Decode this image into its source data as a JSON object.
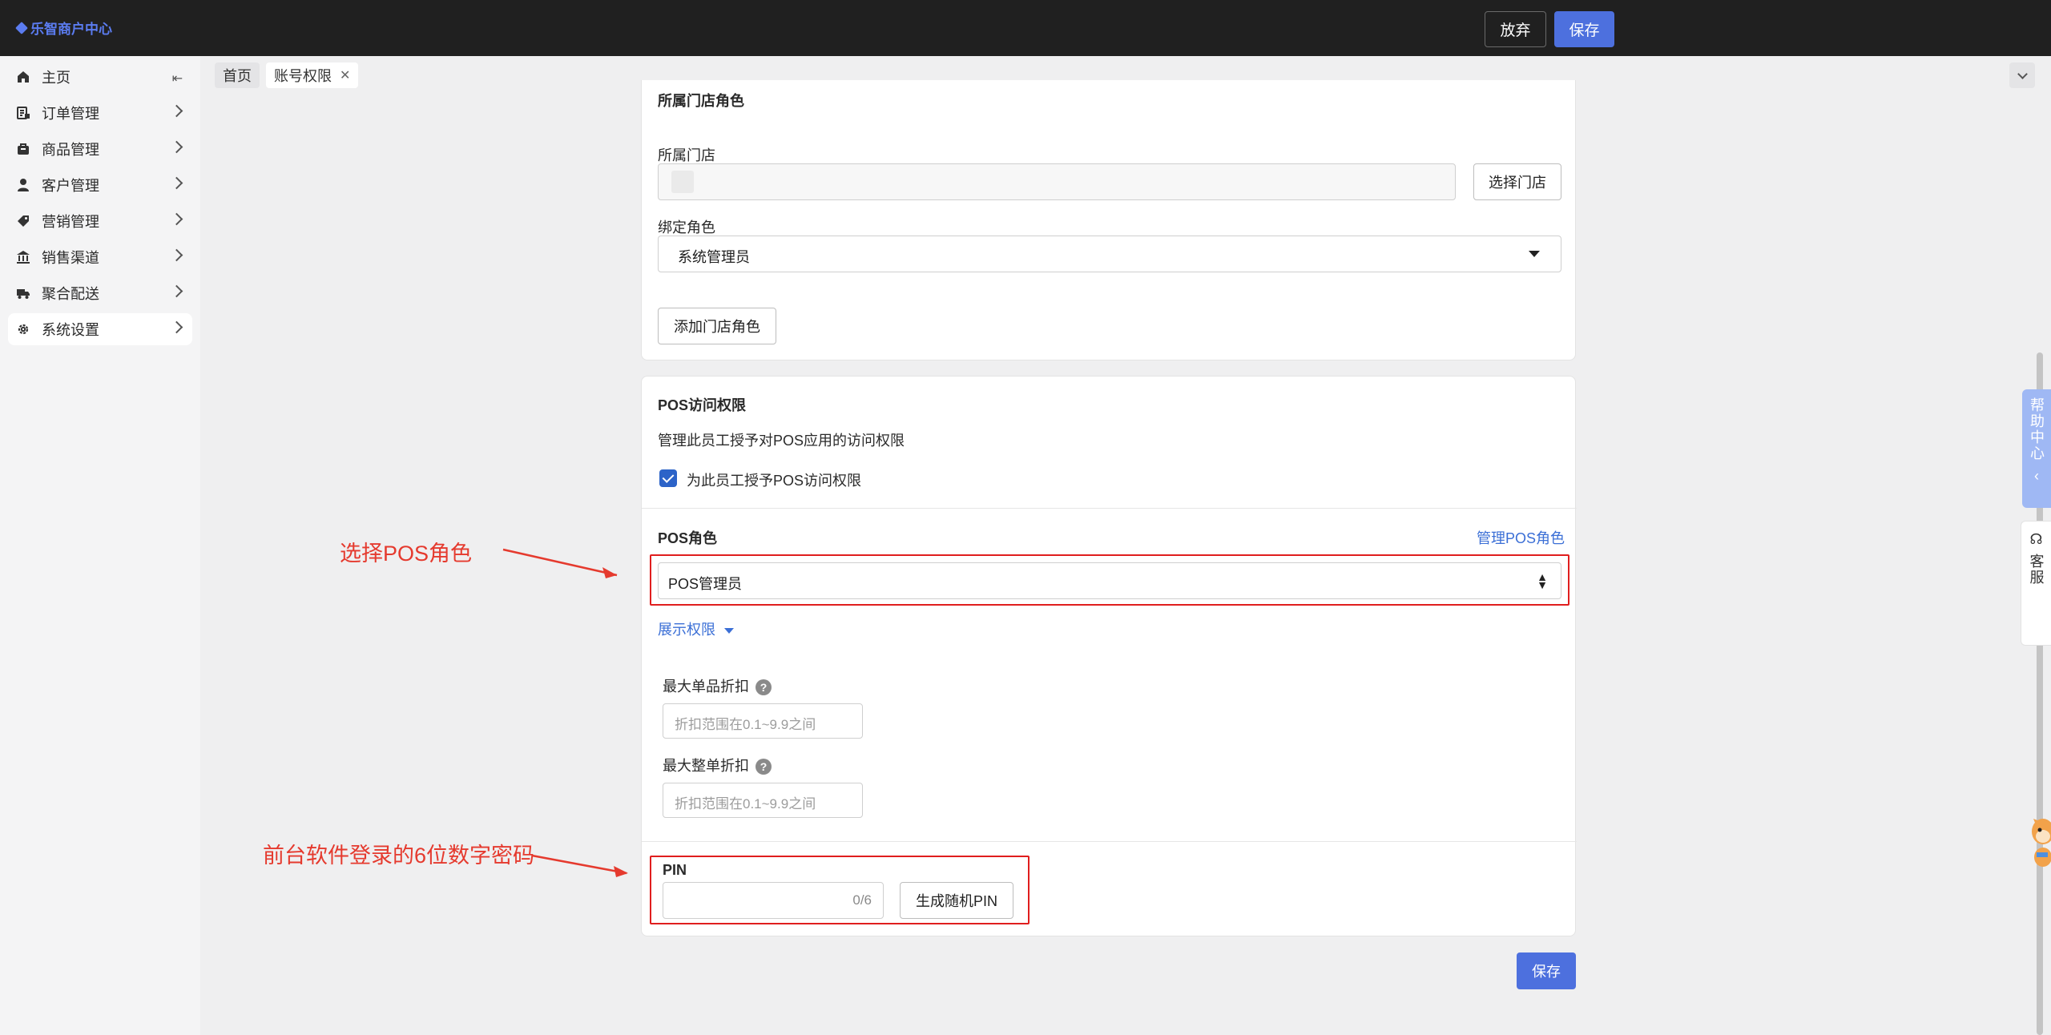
{
  "header": {
    "logo_text": "乐智商户中心",
    "discard_label": "放弃",
    "save_label": "保存"
  },
  "sidebar": {
    "items": [
      {
        "label": "主页",
        "icon": "home-icon"
      },
      {
        "label": "订单管理",
        "icon": "order-icon"
      },
      {
        "label": "商品管理",
        "icon": "product-icon"
      },
      {
        "label": "客户管理",
        "icon": "user-icon"
      },
      {
        "label": "营销管理",
        "icon": "tag-icon"
      },
      {
        "label": "销售渠道",
        "icon": "bank-icon"
      },
      {
        "label": "聚合配送",
        "icon": "truck-icon"
      },
      {
        "label": "系统设置",
        "icon": "gear-icon"
      }
    ],
    "active_item": "系统设置"
  },
  "tabs": [
    {
      "label": "首页"
    },
    {
      "label": "账号权限"
    }
  ],
  "store_role": {
    "section_title": "所属门店角色",
    "store_label": "所属门店",
    "select_store_button": "选择门店",
    "role_label": "绑定角色",
    "role_value": "系统管理员",
    "add_role_button": "添加门店角色"
  },
  "pos": {
    "section_title": "POS访问权限",
    "description": "管理此员工授予对POS应用的访问权限",
    "grant_checkbox_label": "为此员工授予POS访问权限",
    "grant_checked": true,
    "role_label": "POS角色",
    "manage_roles_link": "管理POS角色",
    "role_value": "POS管理员",
    "show_permissions_link": "展示权限",
    "max_item_discount_label": "最大单品折扣",
    "max_item_discount_placeholder": "折扣范围在0.1~9.9之间",
    "max_order_discount_label": "最大整单折扣",
    "max_order_discount_placeholder": "折扣范围在0.1~9.9之间",
    "pin_label": "PIN",
    "pin_counter": "0/6",
    "generate_pin_button": "生成随机PIN"
  },
  "footer": {
    "save_label": "保存"
  },
  "annotations": {
    "pos_role": "选择POS角色",
    "pin": "前台软件登录的6位数字密码"
  },
  "float": {
    "help_center": "帮助中心",
    "customer_service": "客服"
  },
  "colors": {
    "primary": "#4d70de",
    "link": "#3b6fd6",
    "annotation": "#e53a2e",
    "topbar": "#202020"
  }
}
